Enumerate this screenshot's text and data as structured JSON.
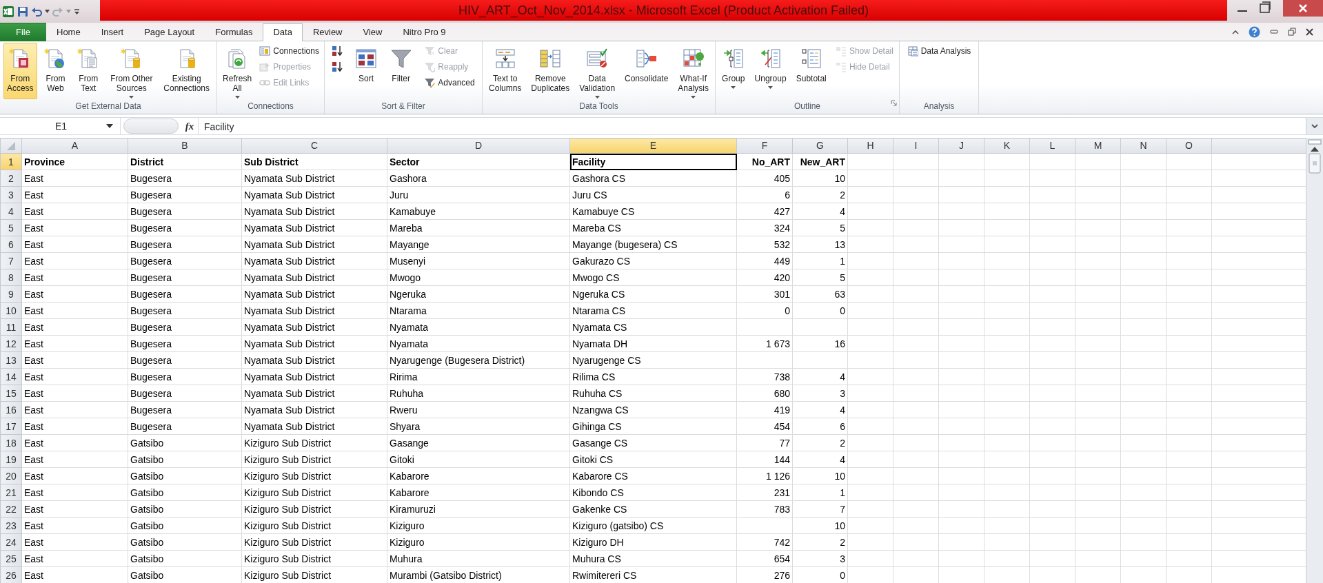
{
  "window": {
    "title": "HIV_ART_Oct_Nov_2014.xlsx - Microsoft Excel (Product Activation Failed)"
  },
  "tabs": [
    {
      "label": "File",
      "kind": "file",
      "selected": false
    },
    {
      "label": "Home",
      "kind": "tab",
      "selected": false
    },
    {
      "label": "Insert",
      "kind": "tab",
      "selected": false
    },
    {
      "label": "Page Layout",
      "kind": "tab",
      "selected": false
    },
    {
      "label": "Formulas",
      "kind": "tab",
      "selected": false
    },
    {
      "label": "Data",
      "kind": "tab",
      "selected": true
    },
    {
      "label": "Review",
      "kind": "tab",
      "selected": false
    },
    {
      "label": "View",
      "kind": "tab",
      "selected": false
    },
    {
      "label": "Nitro Pro 9",
      "kind": "tab",
      "selected": false
    }
  ],
  "ribbon": {
    "groups": [
      {
        "label": "Get External Data",
        "dialog_launcher": false,
        "items": [
          {
            "kind": "large",
            "lines": [
              "From",
              "Access"
            ],
            "dropdown": false,
            "selected": true,
            "disabled": false
          },
          {
            "kind": "large",
            "lines": [
              "From",
              "Web"
            ],
            "dropdown": false,
            "selected": false,
            "disabled": false
          },
          {
            "kind": "large",
            "lines": [
              "From",
              "Text"
            ],
            "dropdown": false,
            "selected": false,
            "disabled": false
          },
          {
            "kind": "large",
            "lines": [
              "From Other",
              "Sources"
            ],
            "dropdown": true,
            "selected": false,
            "disabled": false
          },
          {
            "kind": "large",
            "lines": [
              "Existing",
              "Connections"
            ],
            "dropdown": false,
            "selected": false,
            "disabled": false
          }
        ]
      },
      {
        "label": "Connections",
        "dialog_launcher": false,
        "items": [
          {
            "kind": "large",
            "lines": [
              "Refresh",
              "All"
            ],
            "dropdown": true,
            "selected": false,
            "disabled": false
          },
          {
            "kind": "small",
            "lines": [
              "Connections"
            ],
            "dropdown": false,
            "selected": false,
            "disabled": false
          },
          {
            "kind": "small",
            "lines": [
              "Properties"
            ],
            "dropdown": false,
            "selected": false,
            "disabled": true
          },
          {
            "kind": "small",
            "lines": [
              "Edit Links"
            ],
            "dropdown": false,
            "selected": false,
            "disabled": true
          }
        ]
      },
      {
        "label": "Sort & Filter",
        "dialog_launcher": false,
        "items": [
          {
            "kind": "icon",
            "dropdown": false,
            "selected": false,
            "disabled": false
          },
          {
            "kind": "icon",
            "dropdown": false,
            "selected": false,
            "disabled": false
          },
          {
            "kind": "large",
            "lines": [
              "Sort"
            ],
            "dropdown": false,
            "selected": false,
            "disabled": false
          },
          {
            "kind": "large",
            "lines": [
              "Filter"
            ],
            "dropdown": false,
            "selected": false,
            "disabled": false
          },
          {
            "kind": "small",
            "lines": [
              "Clear"
            ],
            "dropdown": false,
            "selected": false,
            "disabled": true
          },
          {
            "kind": "small",
            "lines": [
              "Reapply"
            ],
            "dropdown": false,
            "selected": false,
            "disabled": true
          },
          {
            "kind": "small",
            "lines": [
              "Advanced"
            ],
            "dropdown": false,
            "selected": false,
            "disabled": false
          }
        ]
      },
      {
        "label": "Data Tools",
        "dialog_launcher": false,
        "items": [
          {
            "kind": "large",
            "lines": [
              "Text to",
              "Columns"
            ],
            "dropdown": false,
            "selected": false,
            "disabled": false
          },
          {
            "kind": "large",
            "lines": [
              "Remove",
              "Duplicates"
            ],
            "dropdown": false,
            "selected": false,
            "disabled": false
          },
          {
            "kind": "large",
            "lines": [
              "Data",
              "Validation"
            ],
            "dropdown": true,
            "selected": false,
            "disabled": false
          },
          {
            "kind": "large",
            "lines": [
              "Consolidate"
            ],
            "dropdown": false,
            "selected": false,
            "disabled": false
          },
          {
            "kind": "large",
            "lines": [
              "What-If",
              "Analysis"
            ],
            "dropdown": true,
            "selected": false,
            "disabled": false
          }
        ]
      },
      {
        "label": "Outline",
        "dialog_launcher": true,
        "items": [
          {
            "kind": "large",
            "lines": [
              "Group"
            ],
            "dropdown": true,
            "selected": false,
            "disabled": false
          },
          {
            "kind": "large",
            "lines": [
              "Ungroup"
            ],
            "dropdown": true,
            "selected": false,
            "disabled": false
          },
          {
            "kind": "large",
            "lines": [
              "Subtotal"
            ],
            "dropdown": false,
            "selected": false,
            "disabled": false
          },
          {
            "kind": "small",
            "lines": [
              "Show Detail"
            ],
            "dropdown": false,
            "selected": false,
            "disabled": true
          },
          {
            "kind": "small",
            "lines": [
              "Hide Detail"
            ],
            "dropdown": false,
            "selected": false,
            "disabled": true
          }
        ]
      },
      {
        "label": "Analysis",
        "dialog_launcher": false,
        "items": [
          {
            "kind": "small",
            "lines": [
              "Data Analysis"
            ],
            "dropdown": false,
            "selected": false,
            "disabled": false
          }
        ]
      }
    ]
  },
  "formula_bar": {
    "name_box": "E1",
    "function_symbol": "fx",
    "value": "Facility"
  },
  "sheet": {
    "columns": [
      {
        "label": "A",
        "selected": false
      },
      {
        "label": "B",
        "selected": false
      },
      {
        "label": "C",
        "selected": false
      },
      {
        "label": "D",
        "selected": false
      },
      {
        "label": "E",
        "selected": true
      },
      {
        "label": "F",
        "selected": false
      },
      {
        "label": "G",
        "selected": false
      },
      {
        "label": "H",
        "selected": false
      },
      {
        "label": "I",
        "selected": false
      },
      {
        "label": "J",
        "selected": false
      },
      {
        "label": "K",
        "selected": false
      },
      {
        "label": "L",
        "selected": false
      },
      {
        "label": "M",
        "selected": false
      },
      {
        "label": "N",
        "selected": false
      },
      {
        "label": "O",
        "selected": false
      }
    ],
    "rows": [
      {
        "number": "1",
        "kind": "header",
        "selected": true,
        "province": "Province",
        "district": "District",
        "sub_district": "Sub District",
        "sector": "Sector",
        "facility": "Facility",
        "no_art": "No_ART",
        "new_art": "New_ART"
      },
      {
        "number": "2",
        "kind": "data",
        "selected": false,
        "province": "East",
        "district": "Bugesera",
        "sub_district": "Nyamata Sub District",
        "sector": "Gashora",
        "facility": "Gashora CS",
        "no_art": "405",
        "new_art": "10"
      },
      {
        "number": "3",
        "kind": "data",
        "selected": false,
        "province": "East",
        "district": "Bugesera",
        "sub_district": "Nyamata Sub District",
        "sector": "Juru",
        "facility": "Juru CS",
        "no_art": "6",
        "new_art": "2"
      },
      {
        "number": "4",
        "kind": "data",
        "selected": false,
        "province": "East",
        "district": "Bugesera",
        "sub_district": "Nyamata Sub District",
        "sector": "Kamabuye",
        "facility": "Kamabuye CS",
        "no_art": "427",
        "new_art": "4"
      },
      {
        "number": "5",
        "kind": "data",
        "selected": false,
        "province": "East",
        "district": "Bugesera",
        "sub_district": "Nyamata Sub District",
        "sector": "Mareba",
        "facility": "Mareba CS",
        "no_art": "324",
        "new_art": "5"
      },
      {
        "number": "6",
        "kind": "data",
        "selected": false,
        "province": "East",
        "district": "Bugesera",
        "sub_district": "Nyamata Sub District",
        "sector": "Mayange",
        "facility": "Mayange (bugesera) CS",
        "no_art": "532",
        "new_art": "13"
      },
      {
        "number": "7",
        "kind": "data",
        "selected": false,
        "province": "East",
        "district": "Bugesera",
        "sub_district": "Nyamata Sub District",
        "sector": "Musenyi",
        "facility": "Gakurazo CS",
        "no_art": "449",
        "new_art": "1"
      },
      {
        "number": "8",
        "kind": "data",
        "selected": false,
        "province": "East",
        "district": "Bugesera",
        "sub_district": "Nyamata Sub District",
        "sector": "Mwogo",
        "facility": "Mwogo CS",
        "no_art": "420",
        "new_art": "5"
      },
      {
        "number": "9",
        "kind": "data",
        "selected": false,
        "province": "East",
        "district": "Bugesera",
        "sub_district": "Nyamata Sub District",
        "sector": "Ngeruka",
        "facility": "Ngeruka CS",
        "no_art": "301",
        "new_art": "63"
      },
      {
        "number": "10",
        "kind": "data",
        "selected": false,
        "province": "East",
        "district": "Bugesera",
        "sub_district": "Nyamata Sub District",
        "sector": "Ntarama",
        "facility": "Ntarama CS",
        "no_art": "0",
        "new_art": "0"
      },
      {
        "number": "11",
        "kind": "data",
        "selected": false,
        "province": "East",
        "district": "Bugesera",
        "sub_district": "Nyamata Sub District",
        "sector": "Nyamata",
        "facility": "Nyamata CS"
      },
      {
        "number": "12",
        "kind": "data",
        "selected": false,
        "province": "East",
        "district": "Bugesera",
        "sub_district": "Nyamata Sub District",
        "sector": "Nyamata",
        "facility": "Nyamata DH",
        "no_art": "1 673",
        "new_art": "16"
      },
      {
        "number": "13",
        "kind": "data",
        "selected": false,
        "province": "East",
        "district": "Bugesera",
        "sub_district": "Nyamata Sub District",
        "sector": "Nyarugenge (Bugesera District)",
        "facility": "Nyarugenge CS"
      },
      {
        "number": "14",
        "kind": "data",
        "selected": false,
        "province": "East",
        "district": "Bugesera",
        "sub_district": "Nyamata Sub District",
        "sector": "Ririma",
        "facility": "Rilima CS",
        "no_art": "738",
        "new_art": "4"
      },
      {
        "number": "15",
        "kind": "data",
        "selected": false,
        "province": "East",
        "district": "Bugesera",
        "sub_district": "Nyamata Sub District",
        "sector": "Ruhuha",
        "facility": "Ruhuha CS",
        "no_art": "680",
        "new_art": "3"
      },
      {
        "number": "16",
        "kind": "data",
        "selected": false,
        "province": "East",
        "district": "Bugesera",
        "sub_district": "Nyamata Sub District",
        "sector": "Rweru",
        "facility": "Nzangwa CS",
        "no_art": "419",
        "new_art": "4"
      },
      {
        "number": "17",
        "kind": "data",
        "selected": false,
        "province": "East",
        "district": "Bugesera",
        "sub_district": "Nyamata Sub District",
        "sector": "Shyara",
        "facility": "Gihinga CS",
        "no_art": "454",
        "new_art": "6"
      },
      {
        "number": "18",
        "kind": "data",
        "selected": false,
        "province": "East",
        "district": "Gatsibo",
        "sub_district": "Kiziguro Sub District",
        "sector": "Gasange",
        "facility": "Gasange CS",
        "no_art": "77",
        "new_art": "2"
      },
      {
        "number": "19",
        "kind": "data",
        "selected": false,
        "province": "East",
        "district": "Gatsibo",
        "sub_district": "Kiziguro Sub District",
        "sector": "Gitoki",
        "facility": "Gitoki CS",
        "no_art": "144",
        "new_art": "4"
      },
      {
        "number": "20",
        "kind": "data",
        "selected": false,
        "province": "East",
        "district": "Gatsibo",
        "sub_district": "Kiziguro Sub District",
        "sector": "Kabarore",
        "facility": "Kabarore CS",
        "no_art": "1 126",
        "new_art": "10"
      },
      {
        "number": "21",
        "kind": "data",
        "selected": false,
        "province": "East",
        "district": "Gatsibo",
        "sub_district": "Kiziguro Sub District",
        "sector": "Kabarore",
        "facility": "Kibondo CS",
        "no_art": "231",
        "new_art": "1"
      },
      {
        "number": "22",
        "kind": "data",
        "selected": false,
        "province": "East",
        "district": "Gatsibo",
        "sub_district": "Kiziguro Sub District",
        "sector": "Kiramuruzi",
        "facility": "Gakenke CS",
        "no_art": "783",
        "new_art": "7"
      },
      {
        "number": "23",
        "kind": "data",
        "selected": false,
        "province": "East",
        "district": "Gatsibo",
        "sub_district": "Kiziguro Sub District",
        "sector": "Kiziguro",
        "facility": "Kiziguro (gatsibo) CS",
        "new_art": "10"
      },
      {
        "number": "24",
        "kind": "data",
        "selected": false,
        "province": "East",
        "district": "Gatsibo",
        "sub_district": "Kiziguro Sub District",
        "sector": "Kiziguro",
        "facility": "Kiziguro DH",
        "no_art": "742",
        "new_art": "2"
      },
      {
        "number": "25",
        "kind": "data",
        "selected": false,
        "province": "East",
        "district": "Gatsibo",
        "sub_district": "Kiziguro Sub District",
        "sector": "Muhura",
        "facility": "Muhura CS",
        "no_art": "654",
        "new_art": "3"
      },
      {
        "number": "26",
        "kind": "data",
        "selected": false,
        "province": "East",
        "district": "Gatsibo",
        "sub_district": "Kiziguro Sub District",
        "sector": "Murambi (Gatsibo District)",
        "facility": "Rwimitereri CS",
        "no_art": "276",
        "new_art": "0"
      }
    ]
  }
}
